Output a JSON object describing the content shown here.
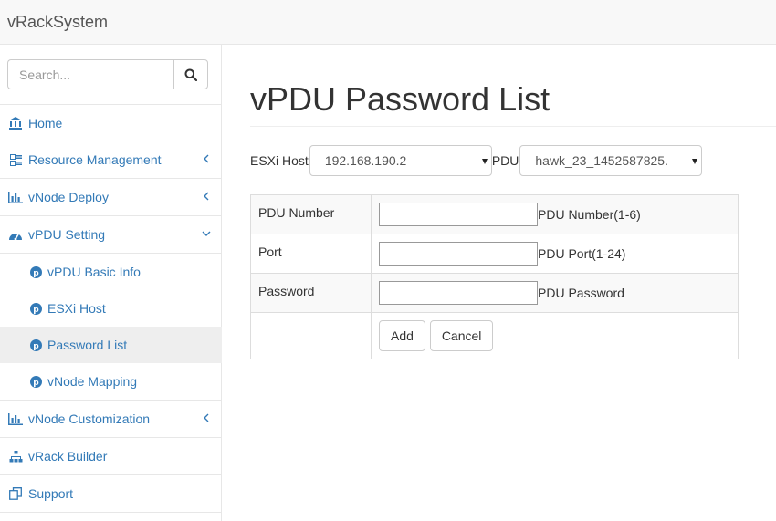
{
  "app": {
    "brand": "vRackSystem"
  },
  "search": {
    "placeholder": "Search..."
  },
  "sidebar": {
    "items": [
      {
        "label": "Home"
      },
      {
        "label": "Resource Management"
      },
      {
        "label": "vNode Deploy"
      },
      {
        "label": "vPDU Setting"
      },
      {
        "label": "vNode Customization"
      },
      {
        "label": "vRack Builder"
      },
      {
        "label": "Support"
      }
    ],
    "vpdu_sub": [
      {
        "label": "vPDU Basic Info"
      },
      {
        "label": "ESXi Host"
      },
      {
        "label": "Password List"
      },
      {
        "label": "vNode Mapping"
      }
    ]
  },
  "main": {
    "title": "vPDU Password List",
    "esxi_label": "ESXi Host",
    "esxi_value": "192.168.190.2",
    "pdu_label": "PDU",
    "pdu_value": "hawk_23_1452587825.",
    "form": {
      "pdu_number_label": "PDU Number",
      "pdu_number_hint": "PDU Number(1-6)",
      "port_label": "Port",
      "port_hint": "PDU Port(1-24)",
      "password_label": "Password",
      "password_hint": "PDU Password",
      "add_label": "Add",
      "cancel_label": "Cancel"
    }
  },
  "colors": {
    "link": "#337ab7",
    "navbar_bg": "#f8f8f8",
    "active_bg": "#eeeeee"
  }
}
